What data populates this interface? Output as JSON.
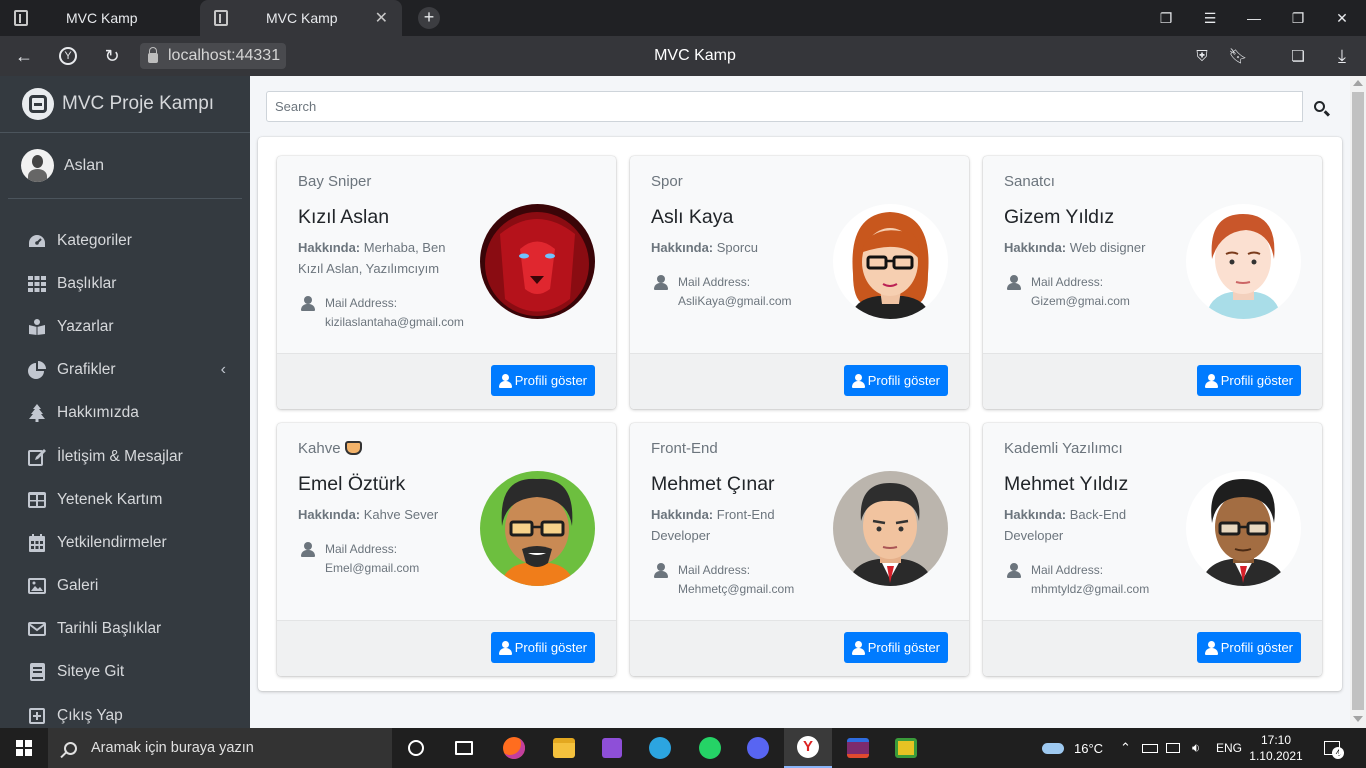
{
  "browser": {
    "tabs": [
      {
        "label": "MVC Kamp",
        "active": false
      },
      {
        "label": "MVC Kamp",
        "active": true
      }
    ],
    "new_tab": "+",
    "close_glyph": "✕",
    "url": "localhost:44331",
    "page_title": "MVC Kamp"
  },
  "sidebar": {
    "brand": "MVC Proje Kampı",
    "user": "Aslan",
    "items": [
      {
        "label": "Kategoriler",
        "icon": "dashboard-icon"
      },
      {
        "label": "Başlıklar",
        "icon": "grid-icon"
      },
      {
        "label": "Yazarlar",
        "icon": "book-reader-icon"
      },
      {
        "label": "Grafikler",
        "icon": "pie-chart-icon"
      },
      {
        "label": "Hakkımızda",
        "icon": "tree-icon"
      },
      {
        "label": "İletişim & Mesajlar",
        "icon": "edit-icon"
      },
      {
        "label": "Yetenek Kartım",
        "icon": "table-icon"
      },
      {
        "label": "Yetkilendirmeler",
        "icon": "calendar-icon"
      },
      {
        "label": "Galeri",
        "icon": "image-icon"
      },
      {
        "label": "Tarihli Başlıklar",
        "icon": "envelope-icon"
      },
      {
        "label": "Siteye Git",
        "icon": "book-icon"
      },
      {
        "label": "Çıkış Yap",
        "icon": "plus-square-icon"
      }
    ]
  },
  "search": {
    "placeholder": "Search"
  },
  "cards": [
    {
      "header": "Bay Sniper",
      "name": "Kızıl Aslan",
      "about_label": "Hakkında:",
      "about": "Merhaba, Ben Kızıl Aslan, Yazılımcıyım",
      "mail_label": "Mail Address:",
      "mail": "kizilaslantaha@gmail.com",
      "button": "Profili göster"
    },
    {
      "header": "Spor",
      "name": "Aslı Kaya",
      "about_label": "Hakkında:",
      "about": "Sporcu",
      "mail_label": "Mail Address:",
      "mail": "AsliKaya@gmail.com",
      "button": "Profili göster"
    },
    {
      "header": "Sanatcı",
      "name": "Gizem Yıldız",
      "about_label": "Hakkında:",
      "about": "Web disigner",
      "mail_label": "Mail Address:",
      "mail": "Gizem@gmai.com",
      "button": "Profili göster"
    },
    {
      "header": "Kahve",
      "name": "Emel Öztürk",
      "about_label": "Hakkında:",
      "about": "Kahve Sever",
      "mail_label": "Mail Address:",
      "mail": "Emel@gmail.com",
      "button": "Profili göster"
    },
    {
      "header": "Front-End",
      "name": "Mehmet Çınar",
      "about_label": "Hakkında:",
      "about": "Front-End Developer",
      "mail_label": "Mail Address:",
      "mail": "Mehmetç@gmail.com",
      "button": "Profili göster"
    },
    {
      "header": "Kademli Yazılımcı",
      "name": "Mehmet Yıldız",
      "about_label": "Hakkında:",
      "about": "Back-End Developer",
      "mail_label": "Mail Address:",
      "mail": "mhmtyldz@gmail.com",
      "button": "Profili göster"
    }
  ],
  "taskbar": {
    "search_placeholder": "Aramak için buraya yazın",
    "weather": "16°C",
    "language": "ENG",
    "time": "17:10",
    "date": "1.10.2021",
    "notifications": "4"
  },
  "colors": {
    "sidebar_bg": "#343a40",
    "primary_button": "#007bff",
    "content_bg": "#f4f6f9"
  }
}
